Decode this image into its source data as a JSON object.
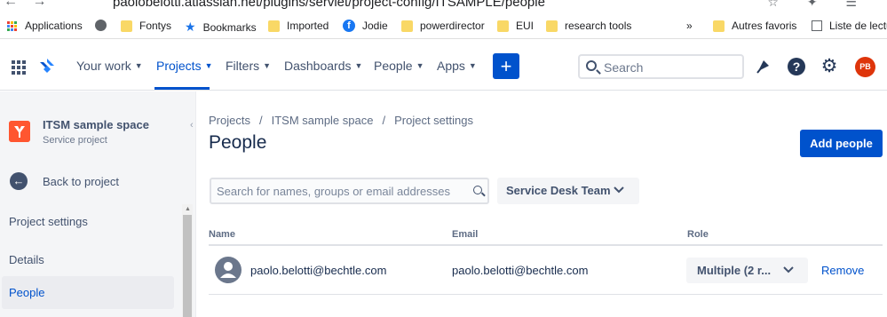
{
  "browser": {
    "url": "paolobelotti.atlassian.net/plugins/servlet/project-config/ITSAMPLE/people",
    "bookmarks": [
      {
        "label": "Applications",
        "icon": "apps-grid-icon"
      },
      {
        "label": "Fontys",
        "icon": "folder-icon"
      },
      {
        "label": "Bookmarks",
        "icon": "star-icon"
      },
      {
        "label": "Imported",
        "icon": "folder-icon"
      },
      {
        "label": "Jodie",
        "icon": "facebook-icon"
      },
      {
        "label": "powerdirector",
        "icon": "folder-icon"
      },
      {
        "label": "EUI",
        "icon": "folder-icon"
      },
      {
        "label": "research tools",
        "icon": "folder-icon"
      },
      {
        "label": "Autres favoris",
        "icon": "folder-icon"
      },
      {
        "label": "Liste de lectu",
        "icon": "reading-list-icon"
      }
    ],
    "overflow_label": "»"
  },
  "topnav": {
    "your_work": "Your work",
    "projects": "Projects",
    "filters": "Filters",
    "dashboards": "Dashboards",
    "people": "People",
    "apps": "Apps",
    "create": "+",
    "search_placeholder": "Search",
    "help": "?",
    "avatar_initials": "PB",
    "accent": "#0052cc",
    "avatar_color": "#de350b"
  },
  "sidebar": {
    "project_name": "ITSM sample space",
    "project_type": "Service project",
    "back_label": "Back to project",
    "section_heading": "Project settings",
    "items": [
      {
        "label": "Details",
        "selected": false
      },
      {
        "label": "People",
        "selected": true
      }
    ]
  },
  "main": {
    "breadcrumb": [
      "Projects",
      "ITSM sample space",
      "Project settings"
    ],
    "breadcrumb_sep": "/",
    "title": "People",
    "add_button": "Add people",
    "filter_placeholder": "Search for names, groups or email addresses",
    "role_filter": "Service Desk Team",
    "table": {
      "headers": [
        "Name",
        "Email",
        "Role"
      ],
      "rows": [
        {
          "name": "paolo.belotti@bechtle.com",
          "email": "paolo.belotti@bechtle.com",
          "role": "Multiple (2 r...",
          "action": "Remove"
        }
      ]
    }
  }
}
